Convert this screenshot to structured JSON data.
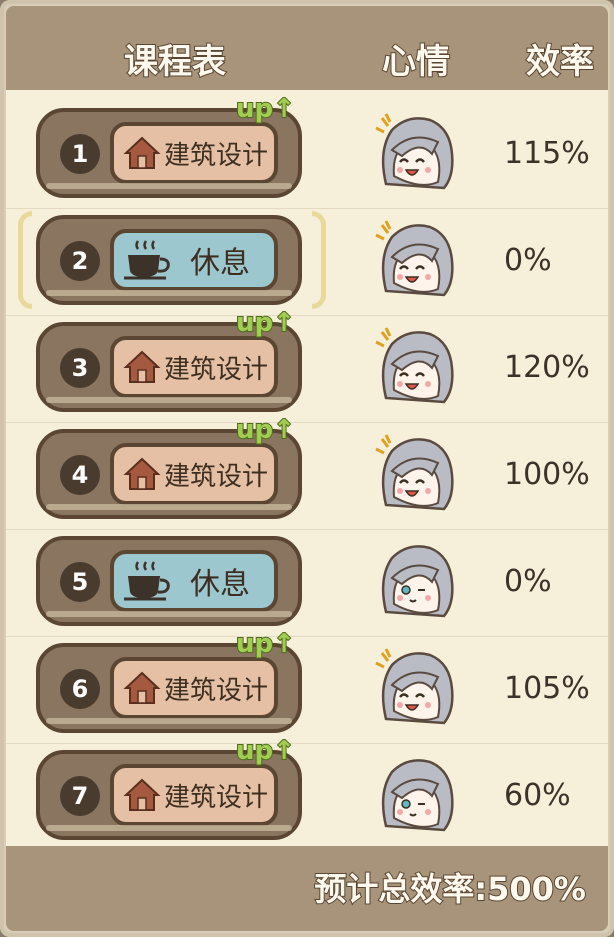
{
  "header": {
    "schedule": "课程表",
    "mood": "心情",
    "efficiency": "效率"
  },
  "rows": [
    {
      "num": "1",
      "course": "建筑设计",
      "type": "build",
      "up": "up",
      "mood": "happy",
      "eff": "115%"
    },
    {
      "num": "2",
      "course": "休息",
      "type": "rest",
      "up": "",
      "mood": "happy",
      "eff": "0%"
    },
    {
      "num": "3",
      "course": "建筑设计",
      "type": "build",
      "up": "up",
      "mood": "happy",
      "eff": "120%"
    },
    {
      "num": "4",
      "course": "建筑设计",
      "type": "build",
      "up": "up",
      "mood": "happy",
      "eff": "100%"
    },
    {
      "num": "5",
      "course": "休息",
      "type": "rest",
      "up": "",
      "mood": "calm",
      "eff": "0%"
    },
    {
      "num": "6",
      "course": "建筑设计",
      "type": "build",
      "up": "up",
      "mood": "happy",
      "eff": "105%"
    },
    {
      "num": "7",
      "course": "建筑设计",
      "type": "build",
      "up": "up",
      "mood": "calm",
      "eff": "60%"
    }
  ],
  "footer": {
    "total": "预计总效率:500%"
  },
  "icons": {
    "build": "house-icon",
    "rest": "coffee-cup-icon",
    "up": "up-arrow-icon"
  },
  "colors": {
    "build": "#e6c0a4",
    "rest": "#9cc7cf",
    "up": "#a2cc52",
    "frame": "#a8947a"
  }
}
